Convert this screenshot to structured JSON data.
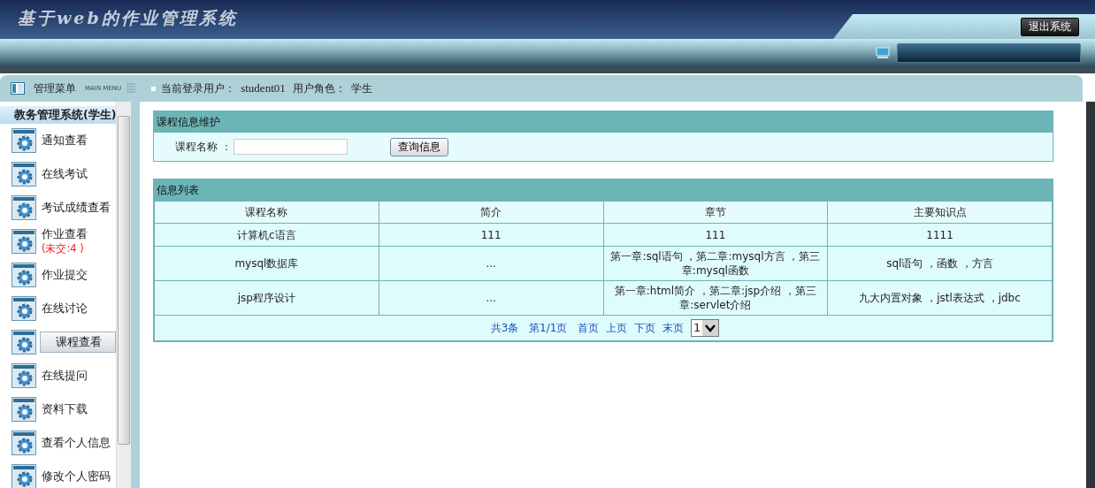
{
  "header": {
    "title": "基于web的作业管理系统",
    "logout_button": "退出系统"
  },
  "menu_bar": {
    "title": "管理菜单",
    "subtitle": "MAIN MENU",
    "user_label": "当前登录用户：",
    "user": "student01",
    "role_label": "用户角色：",
    "role": "学生"
  },
  "sidebar": {
    "title": "教务管理系统(学生)",
    "items": [
      {
        "label": "通知查看",
        "selected": false
      },
      {
        "label": "在线考试",
        "selected": false
      },
      {
        "label": "考试成绩查看",
        "selected": false
      },
      {
        "label": "作业查看",
        "badge": "(未交:4 )",
        "selected": false
      },
      {
        "label": "作业提交",
        "selected": false
      },
      {
        "label": "在线讨论",
        "selected": false
      },
      {
        "label": "课程查看",
        "selected": true
      },
      {
        "label": "在线提问",
        "selected": false
      },
      {
        "label": "资料下载",
        "selected": false
      },
      {
        "label": "查看个人信息",
        "selected": false
      },
      {
        "label": "修改个人密码",
        "selected": false
      }
    ]
  },
  "search": {
    "title": "课程信息维护",
    "field_label": "课程名称 ：",
    "button": "查询信息"
  },
  "table": {
    "title": "信息列表",
    "columns": [
      "课程名称",
      "简介",
      "章节",
      "主要知识点"
    ],
    "rows": [
      [
        "计算机c语言",
        "111",
        "111",
        "1111"
      ],
      [
        "mysql数据库",
        "...",
        "第一章:sql语句 ，第二章:mysql方言 ，第三章:mysql函数",
        "sql语句 ，函数 ，方言"
      ],
      [
        "jsp程序设计",
        "...",
        "第一章:html简介 ，第二章:jsp介绍 ，第三章:servlet介绍",
        "九大内置对象 ，jstl表达式 ，jdbc"
      ]
    ]
  },
  "pagination": {
    "summary": "共3条",
    "page": "第1/1页",
    "links": [
      "首页",
      "上页",
      "下页",
      "末页"
    ],
    "select": "1"
  }
}
